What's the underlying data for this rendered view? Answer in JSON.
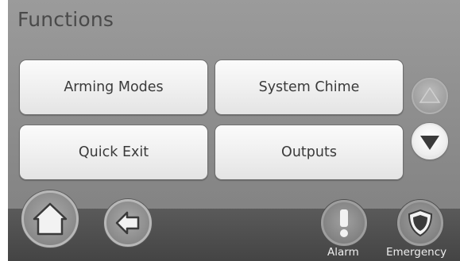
{
  "screen": {
    "title": "Functions"
  },
  "buttons": {
    "arming_modes": "Arming Modes",
    "system_chime": "System Chime",
    "quick_exit": "Quick Exit",
    "outputs": "Outputs"
  },
  "scroll": {
    "up_icon": "triangle-up-icon",
    "down_icon": "triangle-down-icon",
    "up_enabled": false,
    "down_enabled": true
  },
  "bottom_bar": {
    "home_icon": "home-icon",
    "back_icon": "back-arrow-icon",
    "alarm_label": "Alarm",
    "alarm_icon": "exclamation-icon",
    "emergency_label": "Emergency",
    "emergency_icon": "shield-icon"
  }
}
